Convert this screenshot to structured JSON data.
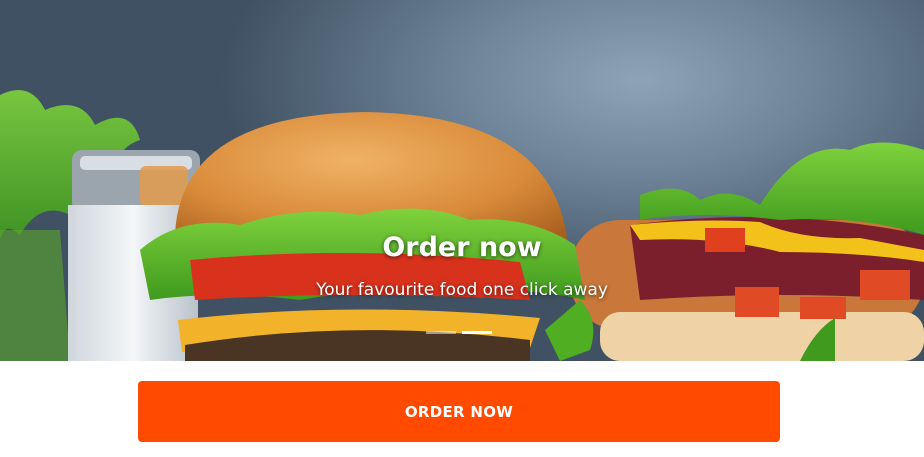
{
  "carousel": {
    "slide_title": "Order now",
    "slide_subtitle": "Your favourite food one click away",
    "slide_count": 2,
    "active_slide": 2,
    "image_description_icon": "burger-hotdog-photo"
  },
  "cta": {
    "order_label": "ORDER NOW"
  },
  "colors": {
    "accent": "#ff4a00",
    "background": "#ffffff"
  }
}
